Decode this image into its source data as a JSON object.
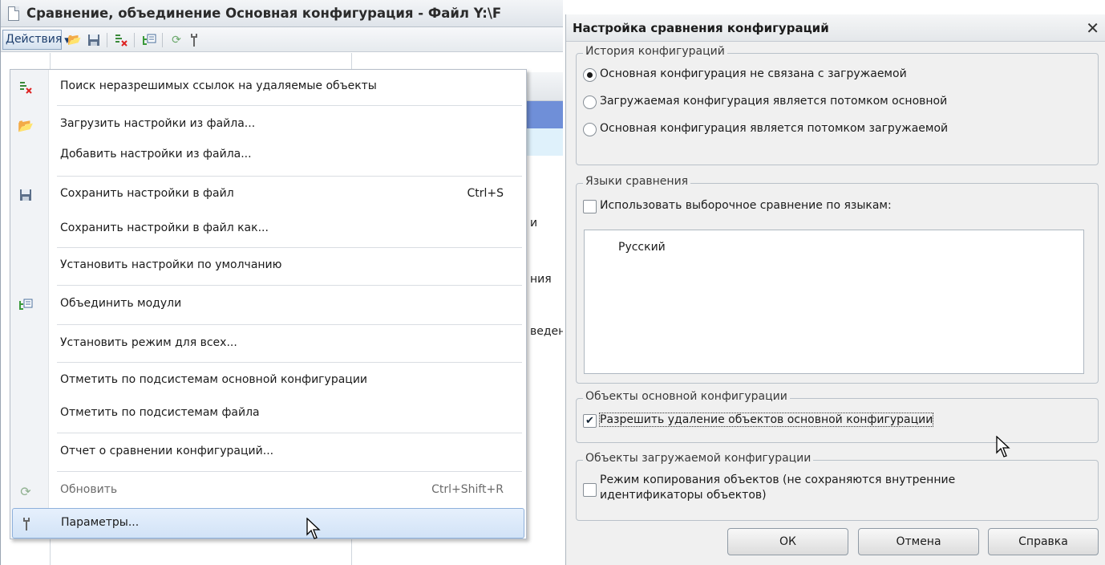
{
  "left_window": {
    "title": "Сравнение, объединение Основная конфигурация - Файл Y:\\F",
    "toolbar": {
      "actions_label": "Действия"
    },
    "background": {
      "row_fragments": [
        "и",
        "ния",
        "веден"
      ]
    },
    "menu": {
      "items": [
        {
          "label": "Поиск неразрешимых ссылок на удаляемые объекты",
          "shortcut": "",
          "icon": "search-links-icon"
        },
        {
          "label": "Загрузить настройки из файла...",
          "shortcut": "",
          "icon": "folder-open-icon"
        },
        {
          "label": "Добавить настройки из файла...",
          "shortcut": "",
          "icon": ""
        },
        {
          "label": "Сохранить настройки в файл",
          "shortcut": "Ctrl+S",
          "icon": "floppy-icon"
        },
        {
          "label": "Сохранить настройки в файл как...",
          "shortcut": "",
          "icon": ""
        },
        {
          "label": "Установить настройки по умолчанию",
          "shortcut": "",
          "icon": ""
        },
        {
          "label": "Объединить модули",
          "shortcut": "",
          "icon": "merge-modules-icon"
        },
        {
          "label": "Установить режим для всех...",
          "shortcut": "",
          "icon": ""
        },
        {
          "label": "Отметить по подсистемам основной конфигурации",
          "shortcut": "",
          "icon": ""
        },
        {
          "label": "Отметить по подсистемам файла",
          "shortcut": "",
          "icon": ""
        },
        {
          "label": "Отчет о сравнении конфигураций...",
          "shortcut": "",
          "icon": ""
        },
        {
          "label": "Обновить",
          "shortcut": "Ctrl+Shift+R",
          "icon": "refresh-icon",
          "disabled": true
        },
        {
          "label": "Параметры...",
          "shortcut": "",
          "icon": "wrench-icon",
          "highlighted": true
        }
      ]
    }
  },
  "dialog": {
    "title": "Настройка сравнения конфигураций",
    "close_glyph": "✕",
    "history": {
      "title": "История конфигураций",
      "options": [
        {
          "label": "Основная конфигурация не связана с загружаемой",
          "selected": true
        },
        {
          "label": "Загружаемая конфигурация является потомком основной",
          "selected": false
        },
        {
          "label": "Основная конфигурация является потомком загружаемой",
          "selected": false
        }
      ]
    },
    "languages": {
      "title": "Языки сравнения",
      "checkbox_label": "Использовать выборочное сравнение по языкам:",
      "checked": false,
      "list": [
        "Русский"
      ]
    },
    "main_objects": {
      "title": "Объекты основной конфигурации",
      "checkbox_label": "Разрешить удаление объектов основной конфигурации",
      "checked": true
    },
    "loaded_objects": {
      "title": "Объекты загружаемой конфигурации",
      "checkbox_label_line1": "Режим копирования объектов (не сохраняются внутренние",
      "checkbox_label_line2": "идентификаторы объектов)",
      "checked": false
    },
    "buttons": {
      "ok": "ОК",
      "cancel": "Отмена",
      "help": "Справка"
    }
  }
}
